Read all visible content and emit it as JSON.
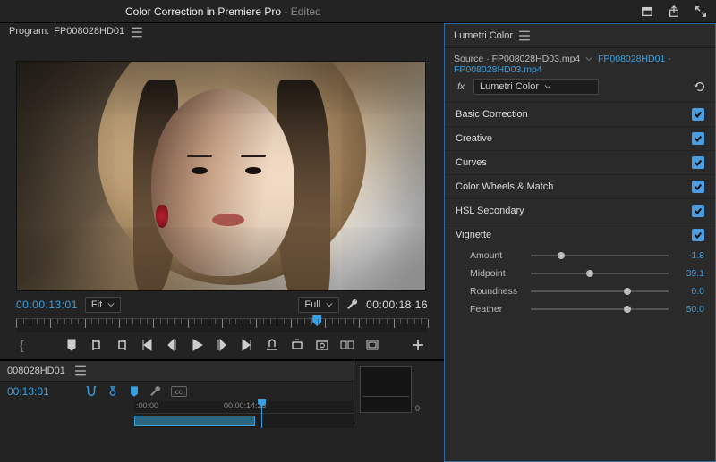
{
  "topbar": {
    "title": "Color Correction in Premiere Pro",
    "edited_suffix": " - Edited"
  },
  "program": {
    "label_prefix": "Program:",
    "sequence_name": "FP008028HD01",
    "current_time": "00:00:13:01",
    "fit_label": "Fit",
    "full_label": "Full",
    "duration": "00:00:18:16"
  },
  "timeline": {
    "tab_name": "008028HD01",
    "current_time": "00:13:01",
    "ruler_labels": [
      ":00:00",
      "00:00:14:23"
    ],
    "playhead_pct": 58
  },
  "scope": {
    "zero_label": "0"
  },
  "lumetri": {
    "panel_title": "Lumetri Color",
    "source_prefix": "Source",
    "source_clip": "FP008028HD03.mp4",
    "link_text": "FP008028HD01 - FP008028HD03.mp4",
    "fx_label": "fx",
    "effect_name": "Lumetri Color",
    "sections": [
      {
        "label": "Basic Correction",
        "checked": true
      },
      {
        "label": "Creative",
        "checked": true
      },
      {
        "label": "Curves",
        "checked": true
      },
      {
        "label": "Color Wheels & Match",
        "checked": true
      },
      {
        "label": "HSL Secondary",
        "checked": true
      },
      {
        "label": "Vignette",
        "checked": true
      }
    ],
    "vignette": {
      "params": [
        {
          "label": "Amount",
          "value": "-1.8",
          "knob_pct": 22
        },
        {
          "label": "Midpoint",
          "value": "39.1",
          "knob_pct": 43
        },
        {
          "label": "Roundness",
          "value": "0.0",
          "knob_pct": 70
        },
        {
          "label": "Feather",
          "value": "50.0",
          "knob_pct": 70
        }
      ]
    }
  }
}
